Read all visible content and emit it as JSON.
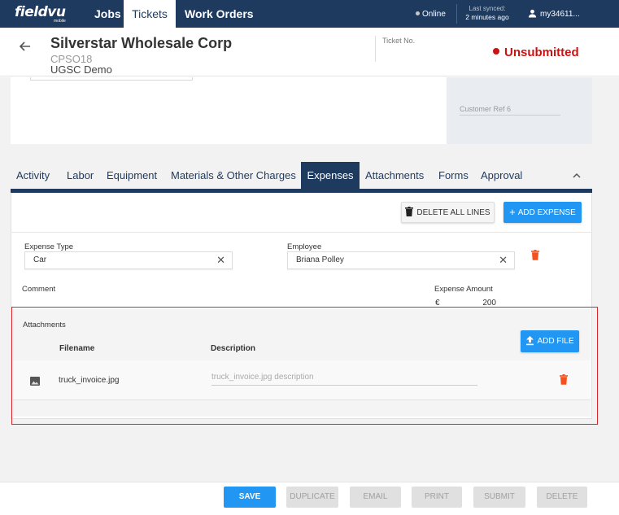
{
  "nav": {
    "logo": "fieldvu",
    "logo_sub": "mobile",
    "items": [
      {
        "label": "Jobs"
      },
      {
        "label": "Tickets"
      },
      {
        "label": "Work Orders"
      }
    ],
    "online": "Online",
    "sync_label": "Last synced:",
    "sync_time": "2 minutes ago",
    "user": "my34611..."
  },
  "header": {
    "customer": "Silverstar Wholesale Corp",
    "code": "CPSO18",
    "org": "UGSC Demo",
    "ticket_no_label": "Ticket No.",
    "status": "Unsubmitted"
  },
  "upper": {
    "customer_ref_label": "Customer Ref 6"
  },
  "tabs": [
    {
      "label": "Activity"
    },
    {
      "label": "Labor"
    },
    {
      "label": "Equipment"
    },
    {
      "label": "Materials & Other Charges"
    },
    {
      "label": "Expenses"
    },
    {
      "label": "Attachments"
    },
    {
      "label": "Forms"
    },
    {
      "label": "Approval"
    }
  ],
  "expense": {
    "delete_all": "DELETE ALL LINES",
    "add_expense": "ADD EXPENSE",
    "type_label": "Expense Type",
    "type_value": "Car",
    "employee_label": "Employee",
    "employee_value": "Briana Polley",
    "comment_label": "Comment",
    "amount_label": "Expense Amount",
    "currency": "€",
    "amount": "200"
  },
  "attachments": {
    "title": "Attachments",
    "col_filename": "Filename",
    "col_description": "Description",
    "add_file": "ADD FILE",
    "rows": [
      {
        "filename": "truck_invoice.jpg",
        "description": "truck_invoice.jpg description"
      }
    ]
  },
  "actions": {
    "save": "SAVE",
    "duplicate": "DUPLICATE",
    "email": "EMAIL",
    "print": "PRINT",
    "submit": "SUBMIT",
    "delete": "DELETE"
  },
  "colors": {
    "nav": "#1e3a5f",
    "accent": "#2196f3",
    "status": "#cc1111",
    "trash": "#f4511e",
    "highlight": "#d9262c"
  }
}
